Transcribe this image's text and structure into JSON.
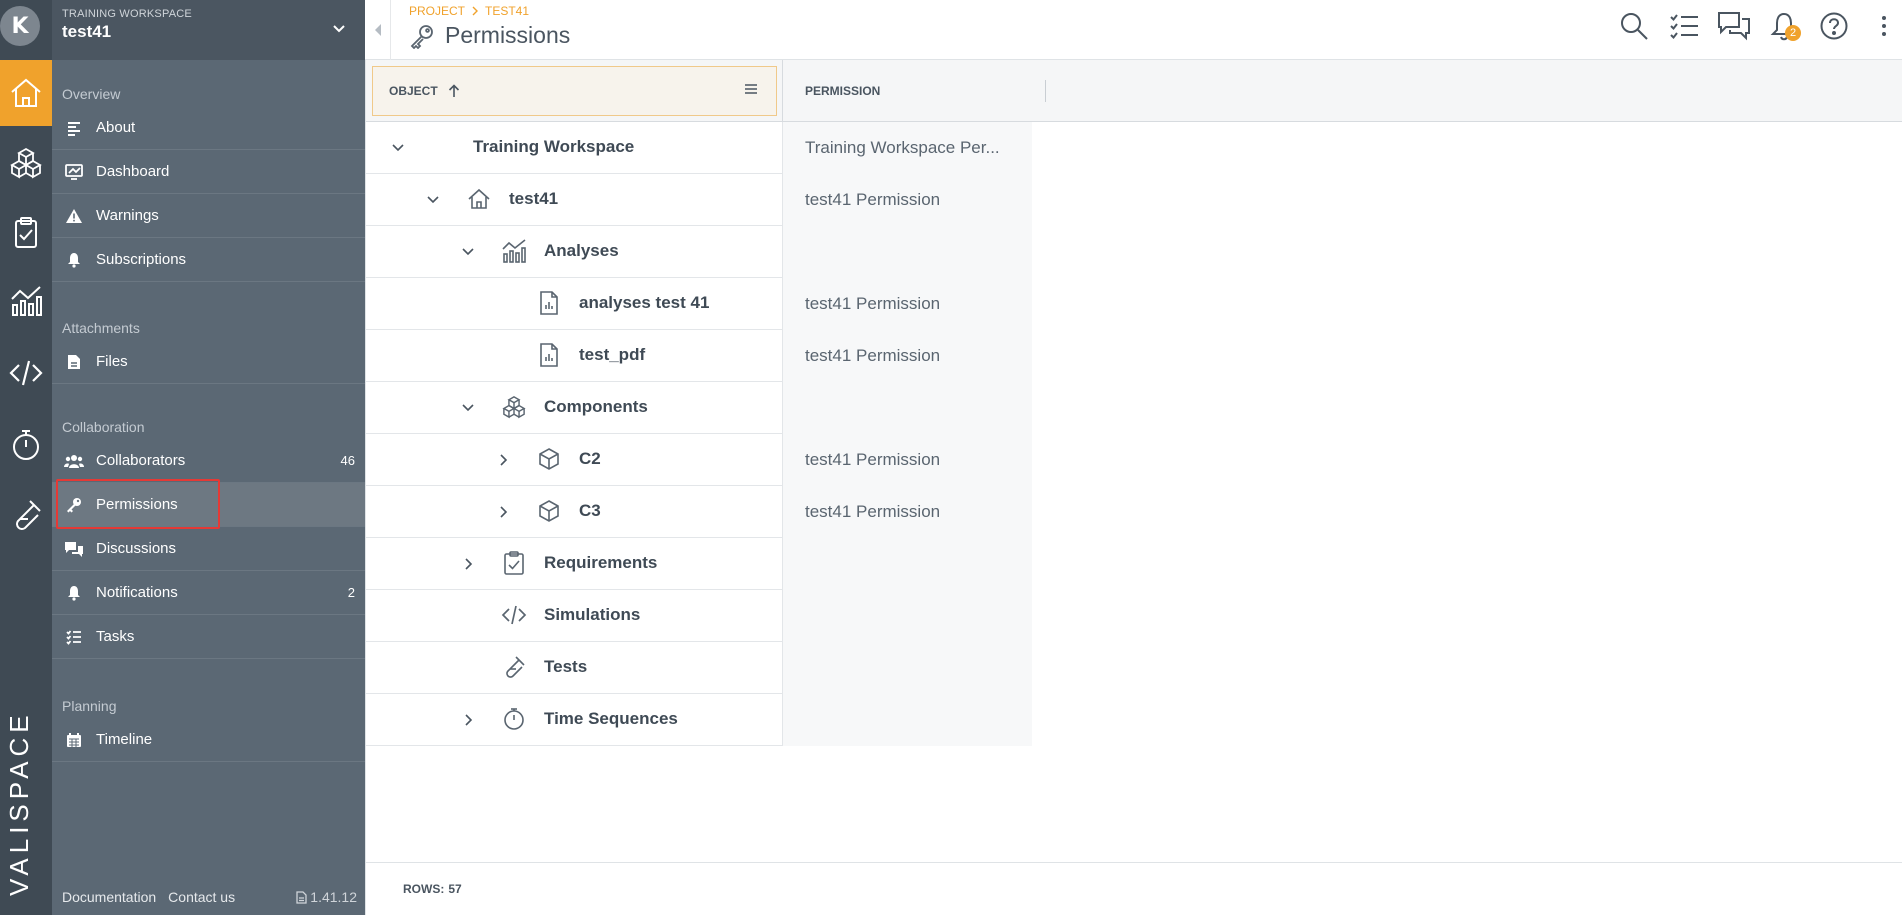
{
  "rail": {
    "avatar_letter": "K",
    "brand_text": "VALISPACE"
  },
  "sidebar": {
    "workspace_label": "TRAINING WORKSPACE",
    "workspace_name": "test41",
    "sections": {
      "overview": "Overview",
      "attachments": "Attachments",
      "collaboration": "Collaboration",
      "planning": "Planning"
    },
    "items": [
      {
        "label": "About"
      },
      {
        "label": "Dashboard"
      },
      {
        "label": "Warnings"
      },
      {
        "label": "Subscriptions"
      },
      {
        "label": "Files"
      },
      {
        "label": "Collaborators",
        "count": "46"
      },
      {
        "label": "Permissions"
      },
      {
        "label": "Discussions"
      },
      {
        "label": "Notifications",
        "count": "2"
      },
      {
        "label": "Tasks"
      },
      {
        "label": "Timeline"
      }
    ],
    "footer": {
      "documentation": "Documentation",
      "contact": "Contact us",
      "version": "1.41.12"
    }
  },
  "topbar": {
    "breadcrumb": [
      "PROJECT",
      "TEST41"
    ],
    "title": "Permissions",
    "notification_badge": "2",
    "icons": [
      "search-icon",
      "task-list-icon",
      "discussions-icon",
      "bell-icon",
      "help-icon",
      "more-vertical-icon"
    ]
  },
  "grid": {
    "columns": {
      "object": "OBJECT",
      "permission": "PERMISSION"
    },
    "rows": [
      {
        "label": "Training Workspace",
        "permission": "Training Workspace Per..."
      },
      {
        "label": "test41",
        "permission": "test41 Permission"
      },
      {
        "label": "Analyses",
        "permission": ""
      },
      {
        "label": "analyses test 41",
        "permission": "test41 Permission"
      },
      {
        "label": "test_pdf",
        "permission": "test41 Permission"
      },
      {
        "label": "Components",
        "permission": ""
      },
      {
        "label": "C2",
        "permission": "test41 Permission"
      },
      {
        "label": "C3",
        "permission": "test41 Permission"
      },
      {
        "label": "Requirements",
        "permission": ""
      },
      {
        "label": "Simulations",
        "permission": ""
      },
      {
        "label": "Tests",
        "permission": ""
      },
      {
        "label": "Time Sequences",
        "permission": ""
      }
    ],
    "footer": {
      "rows_label": "ROWS:",
      "rows_value": "57"
    }
  },
  "colors": {
    "accent": "#f0a22c",
    "rail_bg": "#3f4a54",
    "sidebar_bg": "#5b6874",
    "highlight": "#e53935"
  }
}
